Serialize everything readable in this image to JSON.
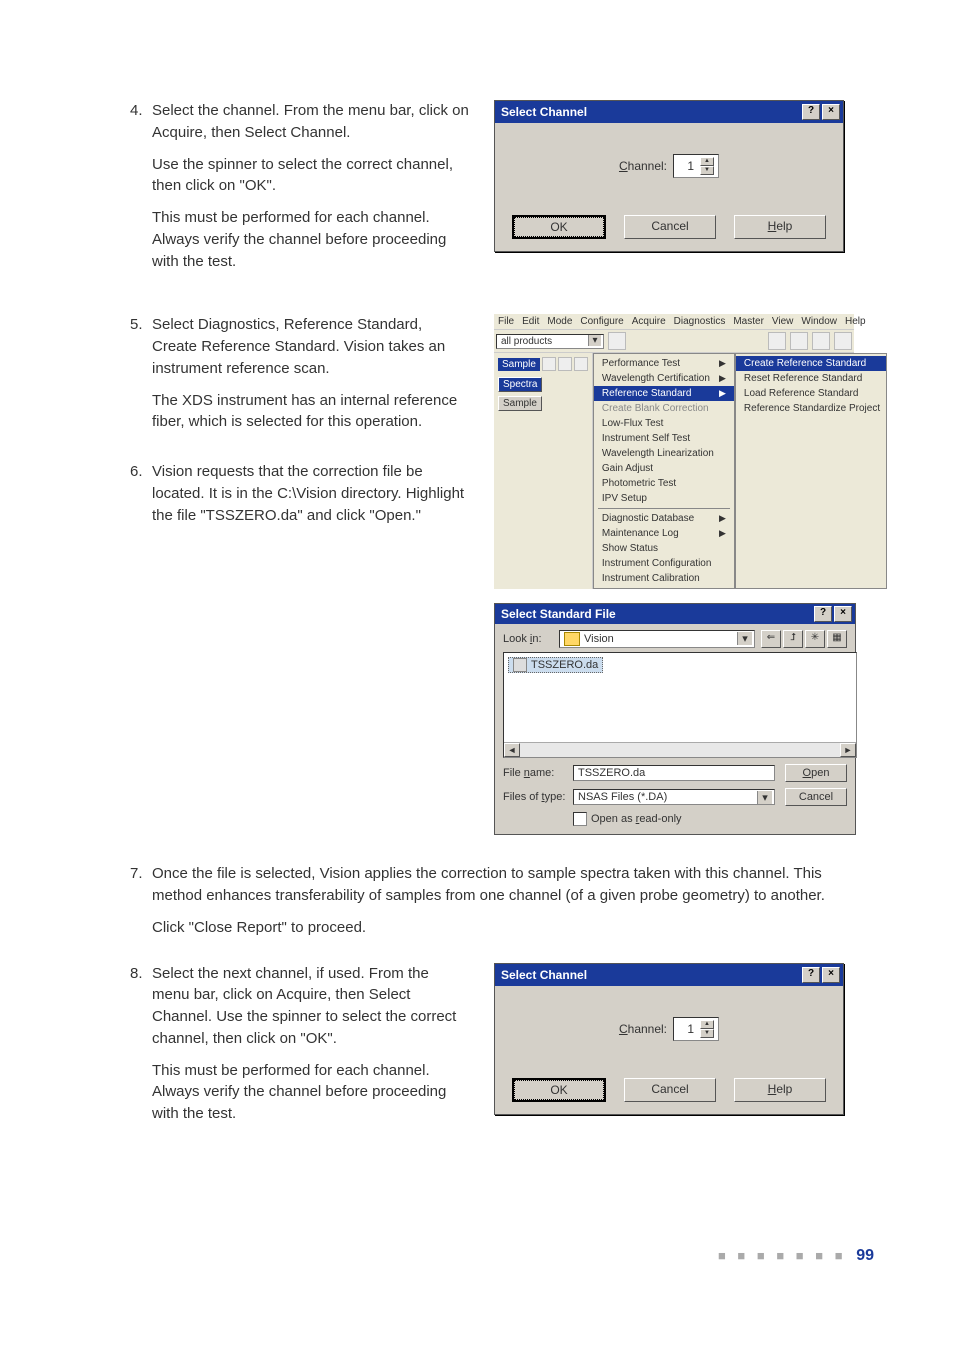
{
  "steps": {
    "s4": {
      "num": "4.",
      "p1": "Select the channel. From the menu bar, click on Acquire, then Select Channel.",
      "p2": "Use the spinner to select the correct channel, then click on \"OK\".",
      "p3": "This must be performed for each channel. Always verify the channel before proceeding with the test."
    },
    "s5": {
      "num": "5.",
      "p1": "Select Diagnostics, Reference Standard, Create Reference Standard. Vision takes an instrument reference scan.",
      "p2": "The XDS instrument has an internal reference fiber, which is selected for this operation."
    },
    "s6": {
      "num": "6.",
      "p1": "Vision requests that the correction file be located. It is in the C:\\Vision directory. Highlight the file \"TSSZERO.da\" and click \"Open.\""
    },
    "s7": {
      "num": "7.",
      "p1": "Once the file is selected, Vision applies the correction to sample spectra taken with this channel. This method enhances transferability of samples from one channel (of a given probe geometry) to another.",
      "p2": "Click \"Close Report\" to proceed."
    },
    "s8": {
      "num": "8.",
      "p1": "Select the next channel, if used. From the menu bar, click on Acquire, then Select Channel. Use the spinner to select the correct channel, then click on \"OK\".",
      "p2": "This must be performed for each channel. Always verify the channel before proceeding with the test."
    }
  },
  "dlg_channel": {
    "title": "Select Channel",
    "label": "Channel:",
    "value": "1",
    "ok": "OK",
    "cancel": "Cancel",
    "help": "Help"
  },
  "menu": {
    "bar": [
      "File",
      "Edit",
      "Mode",
      "Configure",
      "Acquire",
      "Diagnostics",
      "Master",
      "View",
      "Window",
      "Help"
    ],
    "combo": "all products",
    "left_title": "Sample",
    "left_spectra": "Spectra",
    "left_sample": "Sample",
    "diag_items": [
      {
        "t": "Performance Test",
        "arrow": true
      },
      {
        "t": "Wavelength Certification",
        "arrow": true
      },
      {
        "t": "Reference Standard",
        "hl": true,
        "arrow": true
      },
      {
        "t": "Create Blank Correction",
        "grey": true
      },
      {
        "t": "Low-Flux Test"
      },
      {
        "t": "Instrument Self Test"
      },
      {
        "t": "Wavelength Linearization"
      },
      {
        "t": "Gain Adjust"
      },
      {
        "t": "Photometric Test"
      },
      {
        "t": "IPV Setup"
      },
      {
        "t": "__sep"
      },
      {
        "t": "Diagnostic Database",
        "arrow": true
      },
      {
        "t": "Maintenance Log",
        "arrow": true
      },
      {
        "t": "Show Status"
      },
      {
        "t": "Instrument Configuration"
      },
      {
        "t": "Instrument Calibration"
      }
    ],
    "sub_items": [
      {
        "t": "Create Reference Standard",
        "hl": true
      },
      {
        "t": "Reset Reference Standard"
      },
      {
        "t": "Load Reference Standard"
      },
      {
        "t": "Reference Standardize Project"
      }
    ]
  },
  "dlg_open": {
    "title": "Select Standard File",
    "lookin": "Look in:",
    "folder": "Vision",
    "file_in_list": "TSSZERO.da",
    "filename_lbl": "File name:",
    "filename_val": "TSSZERO.da",
    "filetype_lbl": "Files of type:",
    "filetype_val": "NSAS Files (*.DA)",
    "open": "Open",
    "cancel": "Cancel",
    "readonly": "Open as read-only"
  },
  "footer": {
    "page": "99"
  }
}
